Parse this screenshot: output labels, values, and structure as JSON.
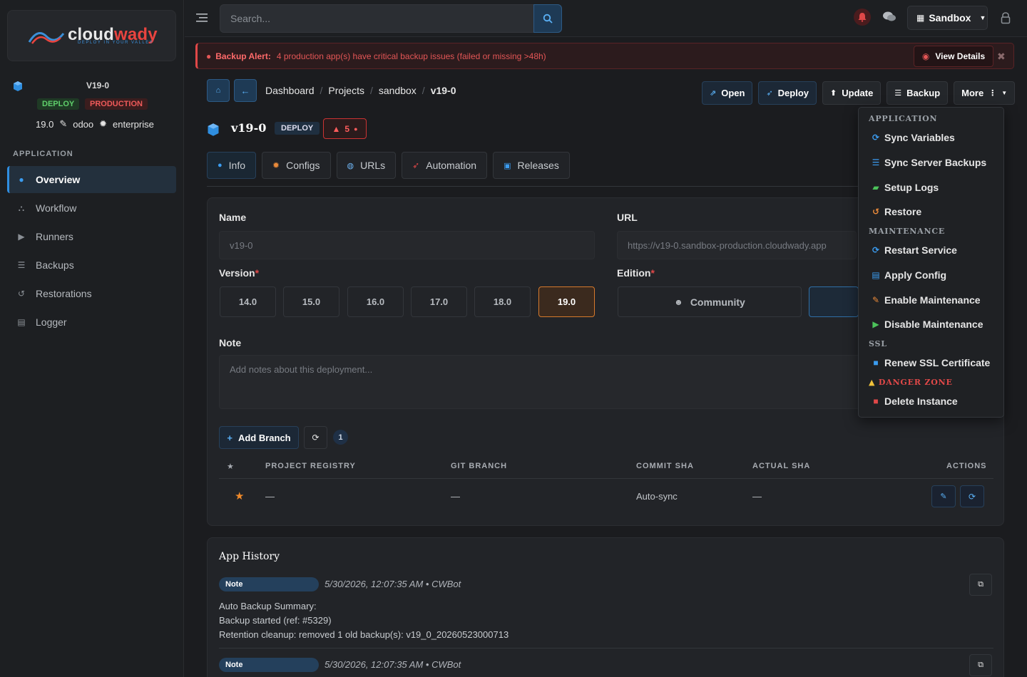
{
  "brand": {
    "name_main": "cloud",
    "name_accent": "wady",
    "tagline": "DEPLOY IN YOUR VALLEY"
  },
  "sidebar": {
    "app_name": "V19-0",
    "badges": [
      "DEPLOY",
      "PRODUCTION"
    ],
    "version": "19.0",
    "odoo": "odoo",
    "edition": "enterprise",
    "section": "APPLICATION",
    "items": [
      {
        "label": "Overview",
        "icon": "info-icon"
      },
      {
        "label": "Workflow",
        "icon": "sitemap-icon"
      },
      {
        "label": "Runners",
        "icon": "play-circle-icon"
      },
      {
        "label": "Backups",
        "icon": "database-icon"
      },
      {
        "label": "Restorations",
        "icon": "history-icon"
      },
      {
        "label": "Logger",
        "icon": "file-icon"
      }
    ]
  },
  "topbar": {
    "search_placeholder": "Search...",
    "environment": "Sandbox"
  },
  "alert": {
    "title": "Backup Alert:",
    "message": "4 production app(s) have critical backup issues (failed or missing >48h)",
    "button": "View Details",
    "color": "#e04848"
  },
  "breadcrumb": [
    "Dashboard",
    "Projects",
    "sandbox",
    "v19-0"
  ],
  "actions": {
    "open": "Open",
    "deploy": "Deploy",
    "update": "Update",
    "backup": "Backup",
    "more": "More"
  },
  "title": {
    "name": "v19-0",
    "badge": "DEPLOY",
    "warnings": "5"
  },
  "tabs": [
    "Info",
    "Configs",
    "URLs",
    "Automation",
    "Releases"
  ],
  "form": {
    "name_label": "Name",
    "name_value": "v19-0",
    "url_label": "URL",
    "url_value": "https://v19-0.sandbox-production.cloudwady.app",
    "version_label": "Version",
    "versions": [
      "14.0",
      "15.0",
      "16.0",
      "17.0",
      "18.0",
      "19.0"
    ],
    "selected_version": "19.0",
    "edition_label": "Edition",
    "edition_options": [
      "Community"
    ],
    "note_label": "Note",
    "note_placeholder": "Add notes about this deployment..."
  },
  "branches": {
    "add_label": "Add Branch",
    "count": "1",
    "headers": [
      "PROJECT REGISTRY",
      "GIT BRANCH",
      "COMMIT SHA",
      "ACTUAL SHA",
      "ACTIONS"
    ],
    "row": {
      "registry": "—",
      "branch": "—",
      "commit": "Auto-sync",
      "actual": "—"
    }
  },
  "history": {
    "title": "App History",
    "entries": [
      {
        "type": "Note",
        "meta": "5/30/2026, 12:07:35 AM • CWBot",
        "lines": [
          "Auto Backup Summary:",
          "Backup started (ref: #5329)",
          "Retention cleanup: removed 1 old backup(s): v19_0_20260523000713"
        ]
      },
      {
        "type": "Note",
        "meta": "5/30/2026, 12:07:35 AM • CWBot",
        "lines": []
      }
    ]
  },
  "more_menu": {
    "sections": [
      {
        "title": "APPLICATION",
        "items": [
          "Sync Variables",
          "Sync Server Backups",
          "Setup Logs",
          "Restore"
        ]
      },
      {
        "title": "MAINTENANCE",
        "items": [
          "Restart Service",
          "Apply Config",
          "Enable Maintenance",
          "Disable Maintenance"
        ]
      },
      {
        "title": "SSL",
        "items": [
          "Renew SSL Certificate"
        ]
      },
      {
        "title": "DANGER ZONE",
        "items": [
          "Delete Instance"
        ]
      }
    ]
  }
}
